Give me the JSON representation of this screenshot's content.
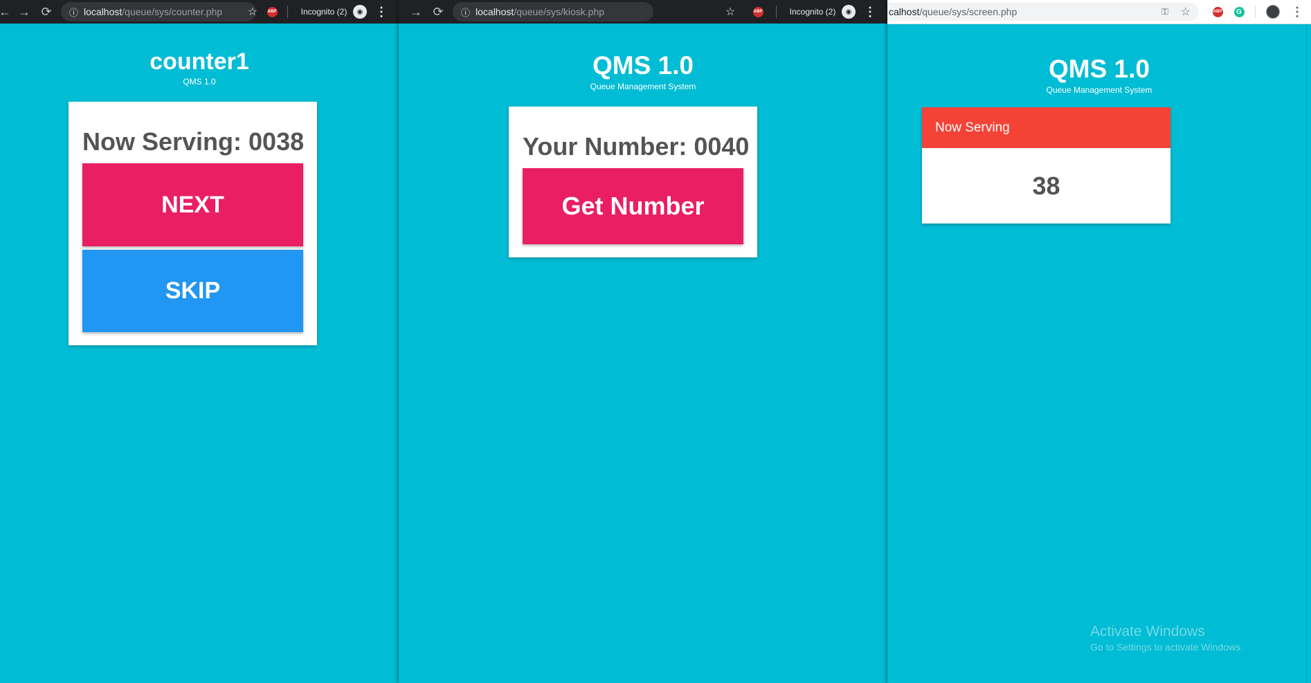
{
  "windows": {
    "counter": {
      "url_host": "localhost",
      "url_path": "/queue/sys/counter.php",
      "incognito_label": "Incognito (2)",
      "abp_label": "ABP",
      "title": "counter1",
      "subtitle": "QMS 1.0",
      "now_serving": "Now Serving: 0038",
      "next_label": "NEXT",
      "skip_label": "SKIP"
    },
    "kiosk": {
      "url_host": "localhost",
      "url_path": "/queue/sys/kiosk.php",
      "incognito_label": "Incognito (2)",
      "abp_label": "ABP",
      "title": "QMS 1.0",
      "subtitle": "Queue Management System",
      "your_number": "Your Number: 0040",
      "get_number_label": "Get Number"
    },
    "screen": {
      "url_host": "calhost",
      "url_path": "/queue/sys/screen.php",
      "abp_label": "ABP",
      "title": "QMS 1.0",
      "subtitle": "Queue Management System",
      "now_serving_header": "Now Serving",
      "now_serving_number": "38"
    }
  },
  "watermark": {
    "title": "Activate Windows",
    "subtitle": "Go to Settings to activate Windows."
  },
  "colors": {
    "page_background": "#00bcd4",
    "next_button": "#e91e63",
    "skip_button": "#2196f3",
    "now_serving_header": "#f44336"
  }
}
